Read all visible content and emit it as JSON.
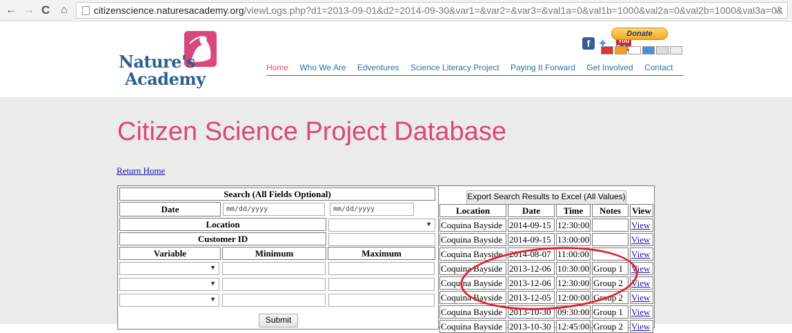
{
  "browser": {
    "url_host": "citizenscience.naturesacademy.org",
    "url_path": "/viewLogs.php?d1=2013-09-01&d2=2014-09-30&var1=&var2=&var3=&val1a=0&val1b=1000&val2a=0&val2b=1000&val3a=0&"
  },
  "logo": {
    "line1": "Nature's",
    "line2": "Academy"
  },
  "donate_label": "Donate",
  "nav": [
    "Home",
    "Who We Are",
    "Edventures",
    "Science Literacy Project",
    "Paying It Forward",
    "Get Involved",
    "Contact"
  ],
  "page_title": "Citizen Science Project Database",
  "return_home": "Return Home",
  "search": {
    "heading": "Search (All Fields Optional)",
    "date_label": "Date",
    "date_placeholder_1": "mm/dd/yyyy",
    "date_placeholder_2": "mm/dd/yyyy",
    "location_label": "Location",
    "customer_id_label": "Customer ID",
    "variable_label": "Variable",
    "minimum_label": "Minimum",
    "maximum_label": "Maximum",
    "submit_label": "Submit"
  },
  "results": {
    "export_label": "Export Search Results to Excel (All Values)",
    "headers": [
      "Location",
      "Date",
      "Time",
      "Notes",
      "View"
    ],
    "rows": [
      [
        "Coquina Bayside",
        "2014-09-15",
        "12:30:00",
        "",
        "View"
      ],
      [
        "Coquina Bayside",
        "2014-09-15",
        "13:00:00",
        "",
        "View"
      ],
      [
        "Coquina Bayside",
        "2014-08-07",
        "11:00:00",
        "",
        "View"
      ],
      [
        "Coquina Bayside",
        "2013-12-06",
        "10:30:00",
        "Group 1",
        "View"
      ],
      [
        "Coquina Bayside",
        "2013-12-06",
        "12:30:00",
        "Group 2",
        "View"
      ],
      [
        "Coquina Bayside",
        "2013-12-05",
        "12:00:00",
        "Group 2",
        "View"
      ],
      [
        "Coquina Bayside",
        "2013-10-30",
        "09:30:00",
        "Group 1",
        "View"
      ],
      [
        "Coquina Bayside",
        "2013-10-30",
        "12:45:00",
        "Group 2",
        "View"
      ]
    ]
  },
  "colors": {
    "brand_pink": "#d9477d",
    "brand_blue": "#2a6fa8",
    "highlight_red": "#e2232a"
  }
}
